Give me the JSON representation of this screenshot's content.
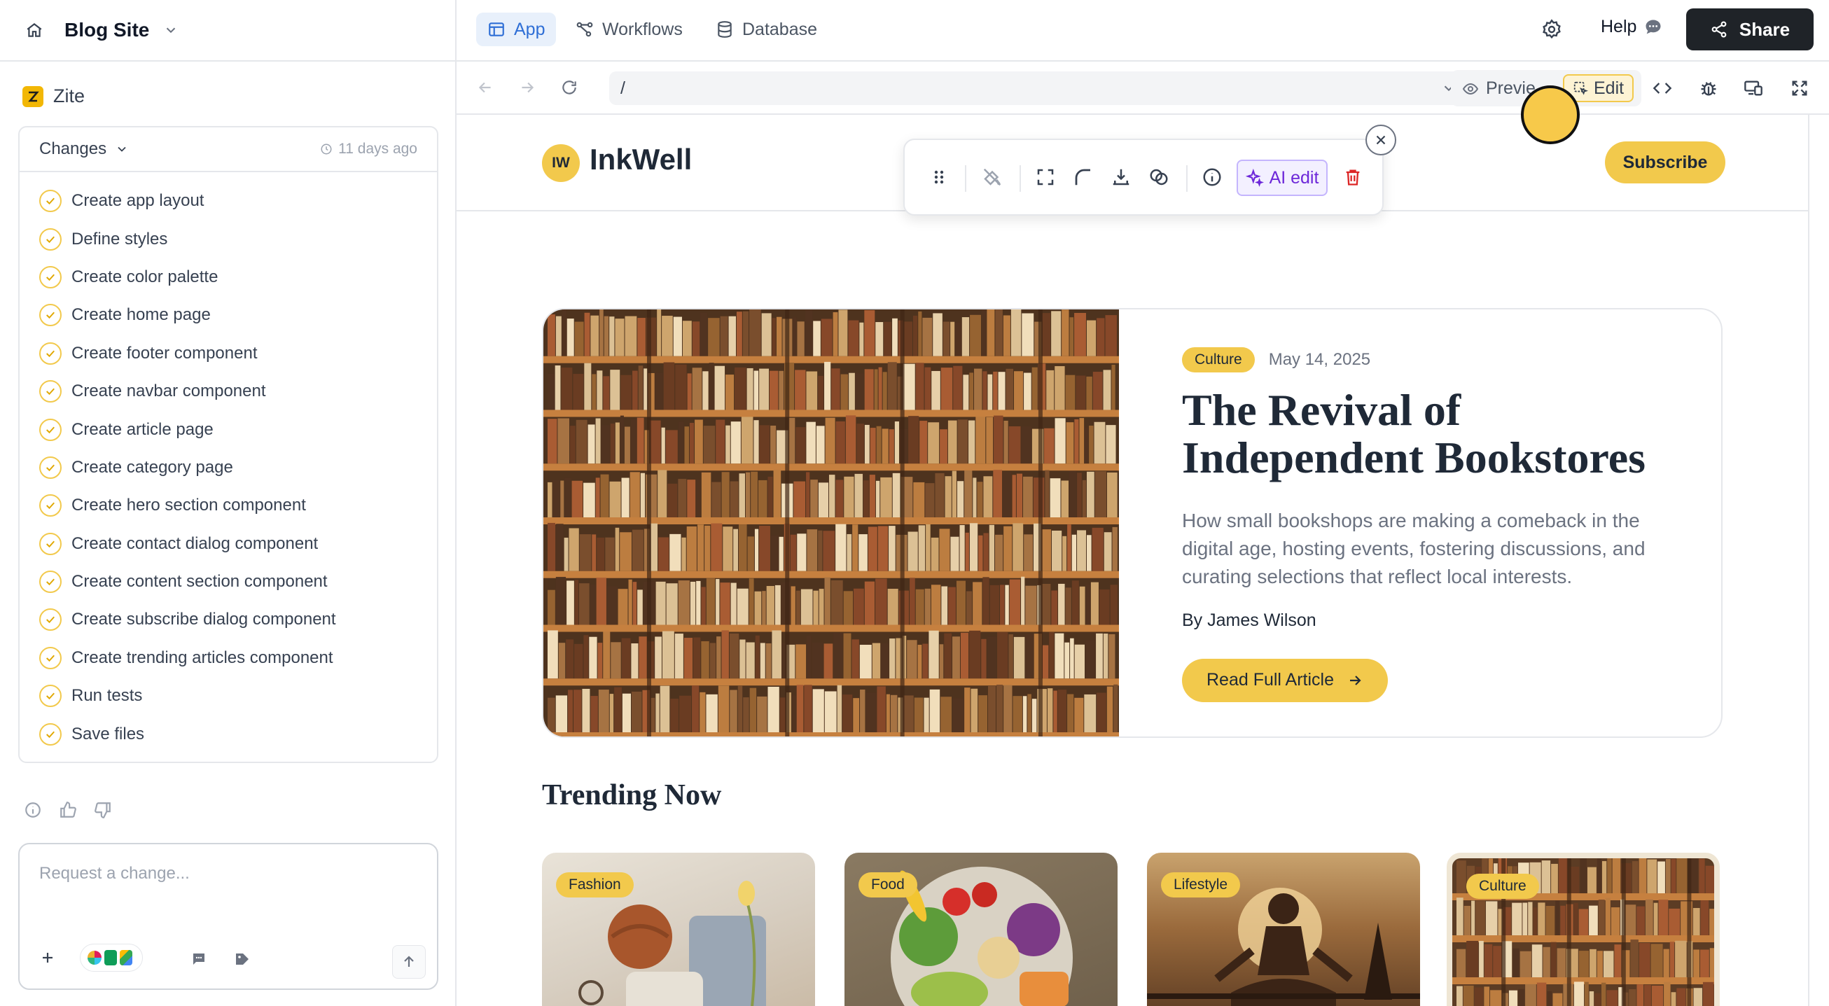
{
  "left_panel": {
    "project_name": "Blog Site",
    "brand": "Zite",
    "changes": {
      "title": "Changes",
      "time": "11 days ago",
      "items": [
        "Create app layout",
        "Define styles",
        "Create color palette",
        "Create home page",
        "Create footer component",
        "Create navbar component",
        "Create article page",
        "Create category page",
        "Create hero section component",
        "Create contact dialog component",
        "Create content section component",
        "Create subscribe dialog component",
        "Create trending articles component",
        "Run tests",
        "Save files"
      ]
    },
    "composer": {
      "placeholder": "Request a change..."
    }
  },
  "topbar": {
    "tabs": [
      {
        "label": "App",
        "icon": "layout-icon",
        "active": true
      },
      {
        "label": "Workflows",
        "icon": "workflow-icon",
        "active": false
      },
      {
        "label": "Database",
        "icon": "database-icon",
        "active": false
      }
    ],
    "help_label": "Help",
    "share_label": "Share"
  },
  "browser": {
    "url": "/",
    "preview_label": "Previe",
    "edit_label": "Edit"
  },
  "toolbar": {
    "ai_edit_label": "AI edit"
  },
  "site": {
    "logo_initials": "IW",
    "logo_text": "InkWell",
    "subscribe_label": "Subscribe",
    "hero": {
      "category": "Culture",
      "date": "May 14, 2025",
      "title": "The Revival of Independent Bookstores",
      "excerpt": "How small bookshops are making a comeback in the digital age, hosting events, fostering discussions, and curating selections that reflect local interests.",
      "author": "By James Wilson",
      "cta": "Read Full Article"
    },
    "trending": {
      "title": "Trending Now",
      "cards": [
        {
          "category": "Fashion"
        },
        {
          "category": "Food"
        },
        {
          "category": "Lifestyle"
        },
        {
          "category": "Culture"
        }
      ]
    }
  },
  "colors": {
    "accent_yellow": "#f2c94c",
    "active_tab_blue": "#2f6fd6",
    "share_dark": "#1f2328",
    "ai_purple": "#6d28d9"
  }
}
